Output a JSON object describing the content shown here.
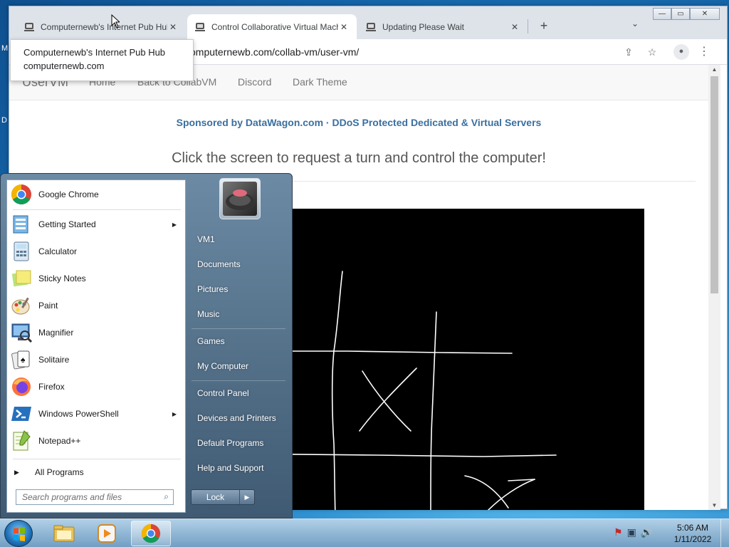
{
  "desktop": {
    "glyph_top": "M",
    "glyph_mid": "D"
  },
  "window": {
    "minimize": "—",
    "maximize": "▭",
    "close": "✕"
  },
  "tabs": [
    {
      "title": "Computernewb's Internet Pub Hub",
      "close": "✕"
    },
    {
      "title": "Control Collaborative Virtual Machine",
      "close": "✕"
    },
    {
      "title": "Updating Please Wait",
      "close": "✕"
    }
  ],
  "new_tab": "+",
  "tab_search": "⌄",
  "address": "computernewb.com/collab-vm/user-vm/",
  "toolbar_icons": {
    "share": "⇪",
    "star": "☆",
    "profile": "●",
    "menu": "⋮"
  },
  "tooltip": {
    "title": "Computernewb's Internet Pub Hub",
    "domain": "computernewb.com"
  },
  "page": {
    "brand": "UserVM",
    "nav": [
      "Home",
      "Back to CollabVM",
      "Discord",
      "Dark Theme"
    ],
    "sponsor": "Sponsored by DataWagon.com · DDoS Protected Dedicated & Virtual Servers",
    "instructions": "Click the screen to request a turn and control the computer!"
  },
  "start_menu": {
    "programs": [
      {
        "label": "Google Chrome",
        "icon": "chrome-icon",
        "submenu": false
      },
      {
        "label": "Getting Started",
        "icon": "getting-started-icon",
        "submenu": true
      },
      {
        "label": "Calculator",
        "icon": "calculator-icon",
        "submenu": false
      },
      {
        "label": "Sticky Notes",
        "icon": "sticky-notes-icon",
        "submenu": false
      },
      {
        "label": "Paint",
        "icon": "paint-icon",
        "submenu": false
      },
      {
        "label": "Magnifier",
        "icon": "magnifier-icon",
        "submenu": false
      },
      {
        "label": "Solitaire",
        "icon": "solitaire-icon",
        "submenu": false
      },
      {
        "label": "Firefox",
        "icon": "firefox-icon",
        "submenu": false
      },
      {
        "label": "Windows PowerShell",
        "icon": "powershell-icon",
        "submenu": true
      },
      {
        "label": "Notepad++",
        "icon": "notepadpp-icon",
        "submenu": false
      }
    ],
    "submenu_arrow": "▶",
    "all_programs": "All Programs",
    "search_placeholder": "Search programs and files",
    "search_icon": "⌕",
    "right_links": [
      "VM1",
      "Documents",
      "Pictures",
      "Music",
      "Games",
      "My Computer",
      "Control Panel",
      "Devices and Printers",
      "Default Programs",
      "Help and Support"
    ],
    "lock": "Lock",
    "lock_arrow": "▶"
  },
  "taskbar": {
    "time": "5:06 AM",
    "date": "1/11/2022"
  }
}
